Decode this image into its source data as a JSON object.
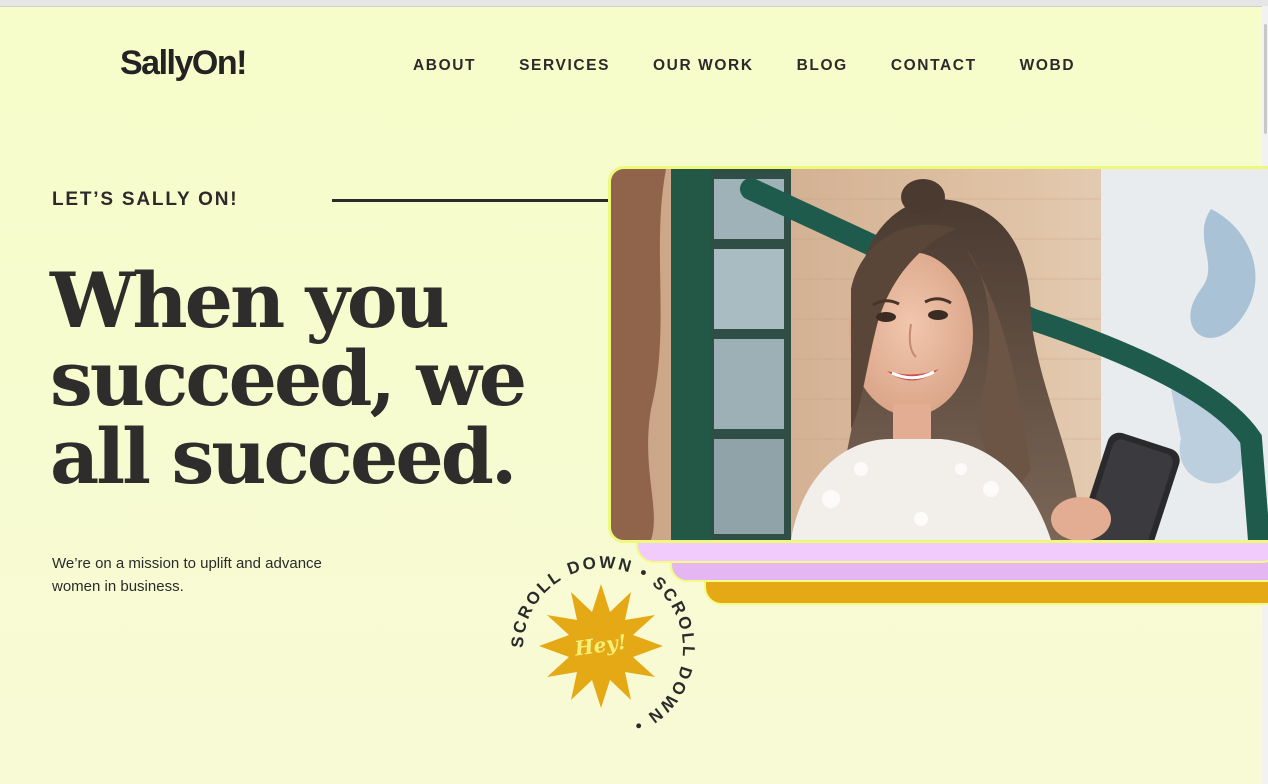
{
  "brand": {
    "logo_text": "SallyOn!"
  },
  "nav": {
    "items": [
      {
        "label": "ABOUT"
      },
      {
        "label": "SERVICES"
      },
      {
        "label": "OUR WORK"
      },
      {
        "label": "BLOG"
      },
      {
        "label": "CONTACT"
      },
      {
        "label": "WOBD"
      }
    ]
  },
  "hero": {
    "eyebrow": "LET’S SALLY ON!",
    "headline_lines": [
      "When you",
      "succeed, we",
      "all succeed."
    ],
    "subtext": "We’re on a mission to uplift and advance women in business.",
    "photo_alt": "Smiling woman with long hair holding a phone outside"
  },
  "scroll_badge": {
    "ring_text": "SCROLL DOWN • SCROLL DOWN •",
    "center_text": "Hey!"
  },
  "colors": {
    "background": "#f7fbd1",
    "text": "#2b2b2b",
    "gold": "#e5a915",
    "pink": "#f1cbfb",
    "lilac": "#e4b6f2",
    "frame": "#eef87a",
    "badge_text": "#f5f07a"
  }
}
